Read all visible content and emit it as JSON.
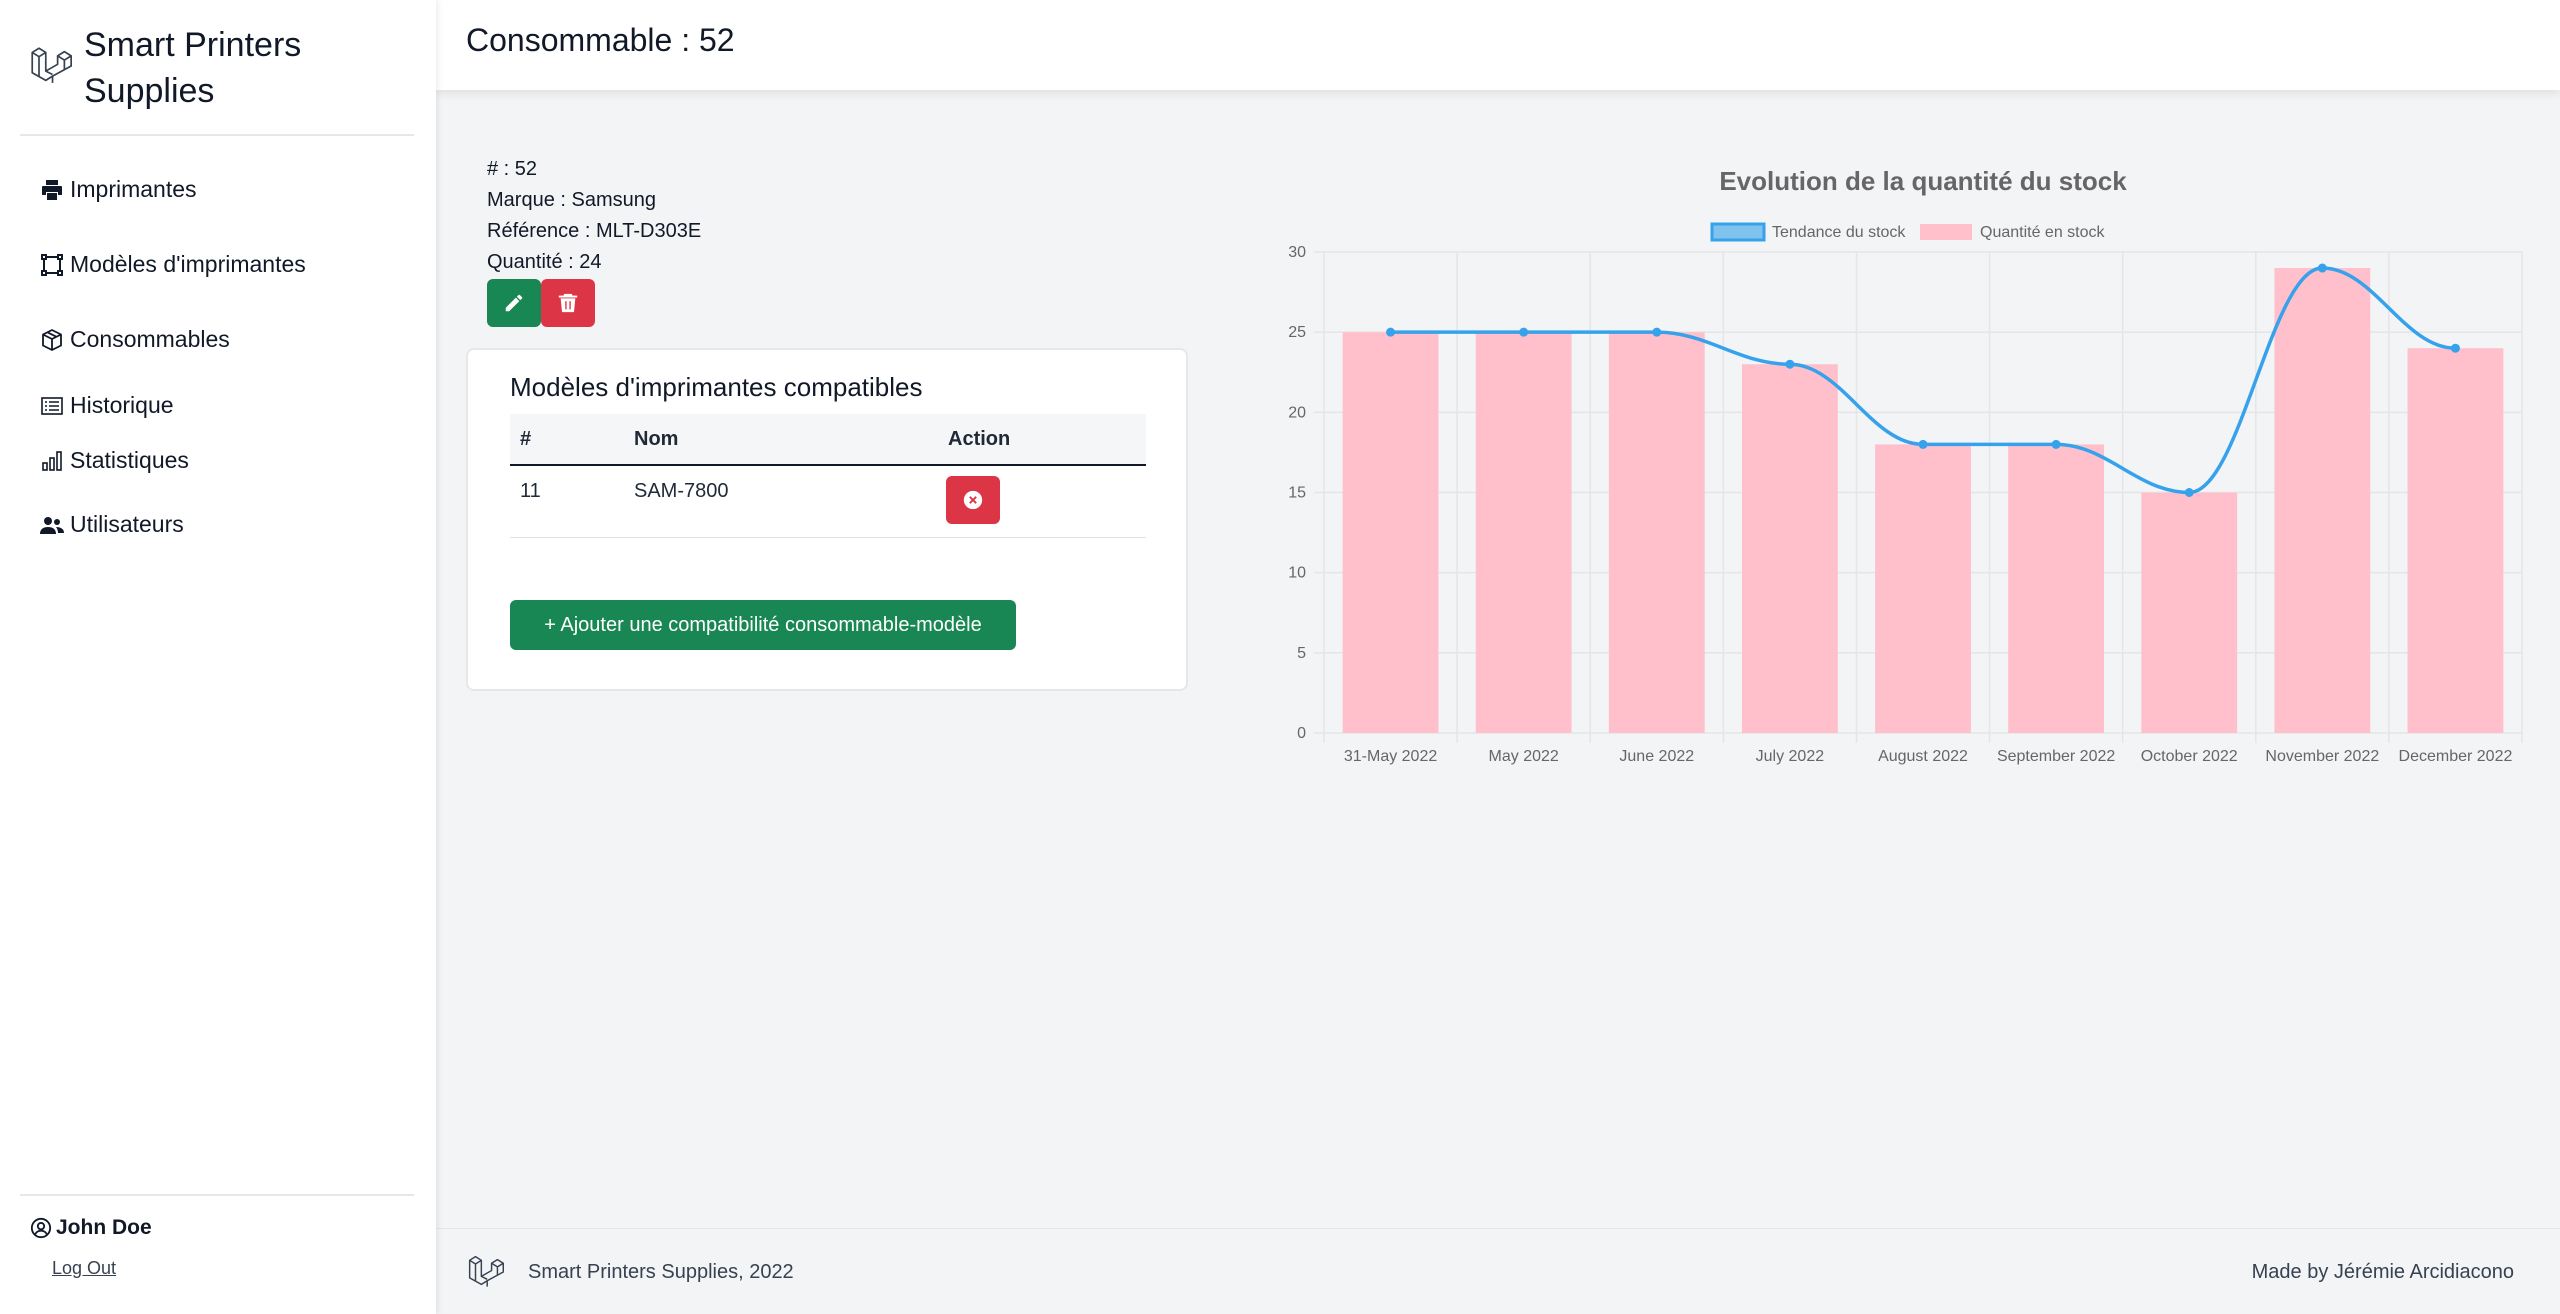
{
  "brand": {
    "name_line1": "Smart Printers",
    "name_line2": "Supplies"
  },
  "sidebar": {
    "items": [
      {
        "label": "Imprimantes",
        "icon": "printer-icon"
      },
      {
        "label": "Modèles d'imprimantes",
        "icon": "vector-square-icon"
      },
      {
        "label": "Consommables",
        "icon": "box-icon"
      },
      {
        "label": "Historique",
        "icon": "list-icon"
      },
      {
        "label": "Statistiques",
        "icon": "bar-chart-icon"
      },
      {
        "label": "Utilisateurs",
        "icon": "users-icon"
      }
    ],
    "user_name": "John Doe",
    "logout_label": "Log Out"
  },
  "header": {
    "title": "Consommable : 52"
  },
  "info": {
    "id_line": "# : 52",
    "brand_line": "Marque : Samsung",
    "reference_line": "Référence : MLT-D303E",
    "quantity_line": "Quantité : 24"
  },
  "compat": {
    "title": "Modèles d'imprimantes compatibles",
    "columns": [
      "#",
      "Nom",
      "Action"
    ],
    "rows": [
      {
        "id": "11",
        "name": "SAM-7800"
      }
    ],
    "add_label": "+ Ajouter une compatibilité consommable-modèle"
  },
  "chart_data": {
    "type": "bar",
    "title": "Evolution de la quantité du stock",
    "categories": [
      "31-May 2022",
      "May 2022",
      "June 2022",
      "July 2022",
      "August 2022",
      "September 2022",
      "October 2022",
      "November 2022",
      "December 2022"
    ],
    "series": [
      {
        "name": "Tendance du stock",
        "type": "line",
        "color": "#36a2eb",
        "values": [
          25,
          25,
          25,
          23,
          18,
          18,
          15,
          29,
          24
        ]
      },
      {
        "name": "Quantité en stock",
        "type": "bar",
        "color": "#ffc0cc",
        "values": [
          25,
          25,
          25,
          23,
          18,
          18,
          15,
          29,
          24
        ]
      }
    ],
    "ylim": [
      0,
      30
    ],
    "yticks": [
      0,
      5,
      10,
      15,
      20,
      25,
      30
    ],
    "grid": true,
    "legend": "top-center"
  },
  "footer": {
    "left": "Smart Printers Supplies, 2022",
    "right": "Made by Jérémie Arcidiacono"
  },
  "colors": {
    "success": "#198754",
    "danger": "#dc3545",
    "line": "#36a2eb",
    "bar": "#ffc0cc"
  }
}
